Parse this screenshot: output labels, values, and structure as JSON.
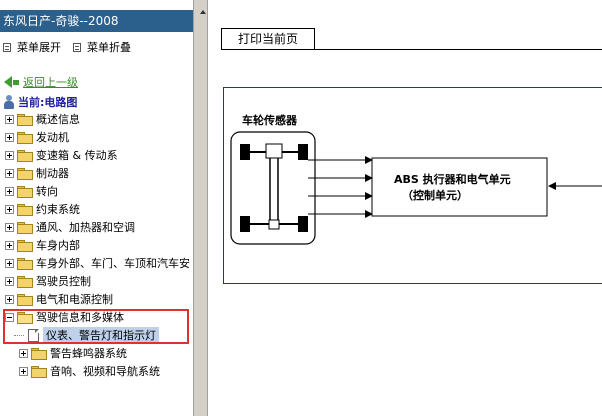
{
  "app": {
    "title": "东风日产-奇骏--2008"
  },
  "toolbar": {
    "expand_label": "菜单展开",
    "collapse_label": "菜单折叠"
  },
  "nav": {
    "back_label": "返回上一级",
    "current_label": "当前:电路图"
  },
  "tree": {
    "items": [
      {
        "label": "概述信息"
      },
      {
        "label": "发动机"
      },
      {
        "label": "变速箱 & 传动系"
      },
      {
        "label": "制动器"
      },
      {
        "label": "转向"
      },
      {
        "label": "约束系统"
      },
      {
        "label": "通风、加热器和空调"
      },
      {
        "label": "车身内部"
      },
      {
        "label": "车身外部、车门、车顶和汽车安"
      },
      {
        "label": "驾驶员控制"
      },
      {
        "label": "电气和电源控制"
      },
      {
        "label": "驾驶信息和多媒体"
      }
    ],
    "selected_child": "仪表、警告灯和指示灯",
    "sub_items": [
      {
        "label": "警告蜂鸣器系统"
      },
      {
        "label": "音响、视频和导航系统"
      }
    ]
  },
  "content": {
    "print_label": "打印当前页",
    "diagram": {
      "sensor_label": "车轮传感器",
      "abs_unit_line1": "ABS 执行器和电气单元",
      "abs_unit_line2": "（控制单元）"
    }
  },
  "colors": {
    "title_bar_bg": "#2b5f8c",
    "highlight_border": "#e03030",
    "diagram_frame": "#2a2aa8",
    "back_link": "#3a8a2a",
    "current_label": "#1f1fa0"
  }
}
